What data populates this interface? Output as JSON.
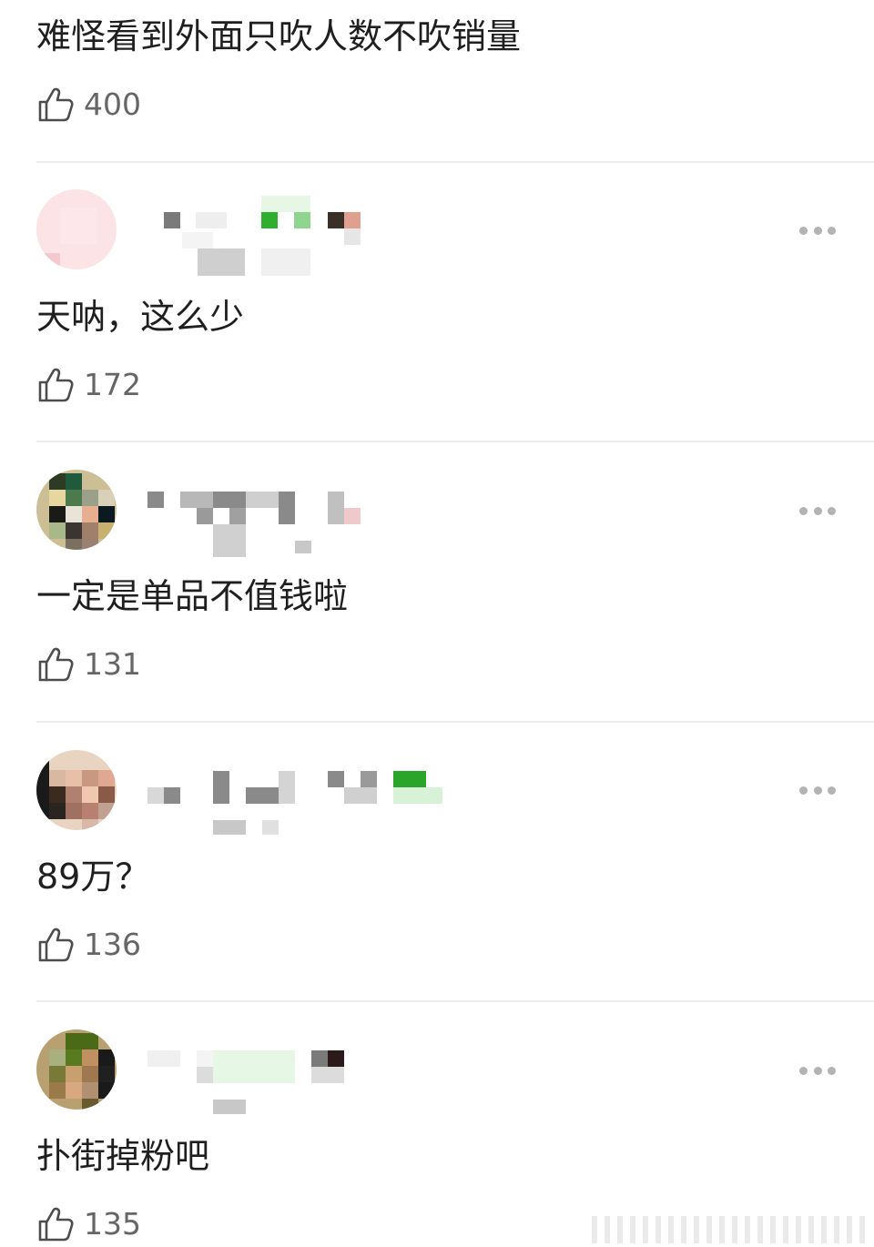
{
  "top_comment": {
    "text": "难怪看到外面只吹人数不吹销量",
    "likes": "400"
  },
  "comments": [
    {
      "text": "天呐，这么少",
      "likes": "172"
    },
    {
      "text": "一定是单品不值钱啦",
      "likes": "131"
    },
    {
      "text": "89万？",
      "likes": "136"
    },
    {
      "text": "扑街掉粉吧",
      "likes": "135"
    }
  ],
  "icons": {
    "like": "thumbs-up-icon",
    "more": "more-dots-icon"
  },
  "colors": {
    "text": "#1f1f1f",
    "like_count": "#666666",
    "divider": "#ececec",
    "more_dots": "#b3b3b3"
  }
}
